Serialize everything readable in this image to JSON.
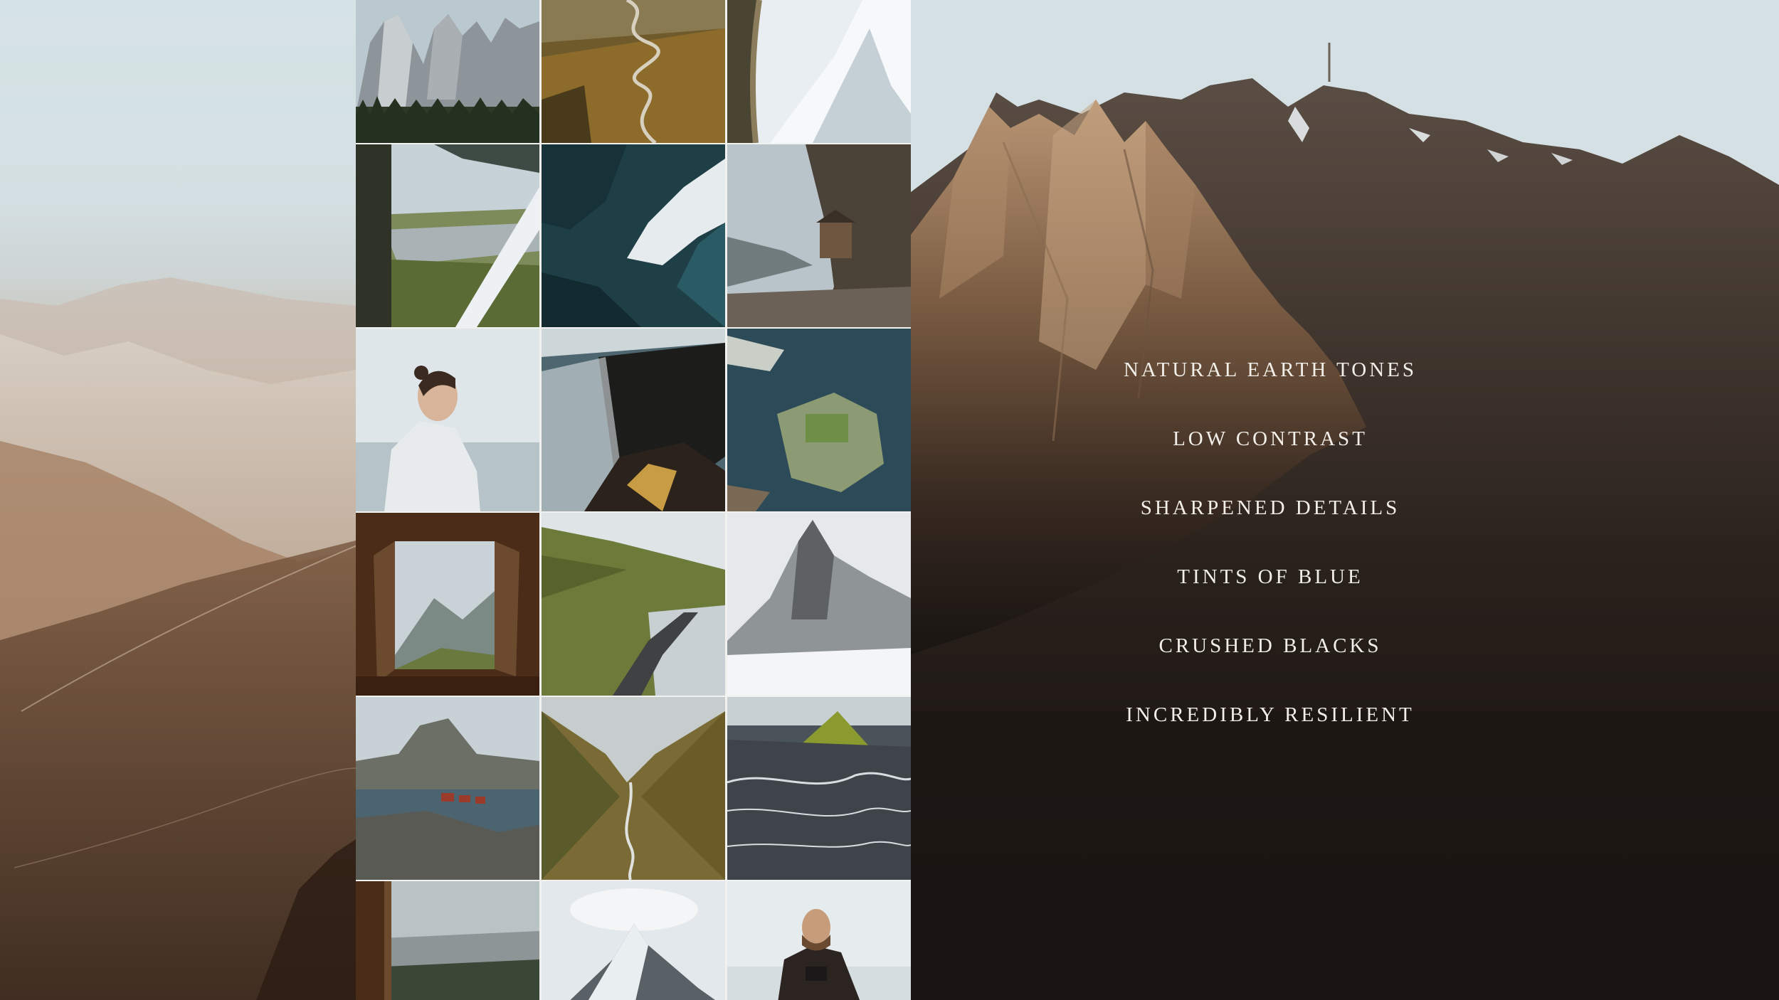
{
  "features": [
    "NATURAL EARTH TONES",
    "LOW CONTRAST",
    "SHARPENED DETAILS",
    "TINTS OF BLUE",
    "CRUSHED BLACKS",
    "INCREDIBLY RESILIENT"
  ],
  "colors": {
    "text": "#f2eee8",
    "sky": "#d3e0e3",
    "earth": "#8f6a4d",
    "dark": "#1a1512"
  },
  "photos": [
    {
      "name": "granite-peaks-photo"
    },
    {
      "name": "winding-road-photo"
    },
    {
      "name": "snowy-ridge-window-photo"
    },
    {
      "name": "plane-window-river-photo"
    },
    {
      "name": "ocean-wave-photo"
    },
    {
      "name": "cliff-house-photo"
    },
    {
      "name": "man-profile-photo"
    },
    {
      "name": "black-beach-photo"
    },
    {
      "name": "island-village-photo"
    },
    {
      "name": "window-mountain-photo"
    },
    {
      "name": "road-lake-photo"
    },
    {
      "name": "snow-peak-photo"
    },
    {
      "name": "lofoten-village-photo"
    },
    {
      "name": "valley-river-photo"
    },
    {
      "name": "green-mountain-photo"
    },
    {
      "name": "cabin-window-photo"
    },
    {
      "name": "matterhorn-photo"
    },
    {
      "name": "man-camera-photo"
    }
  ]
}
